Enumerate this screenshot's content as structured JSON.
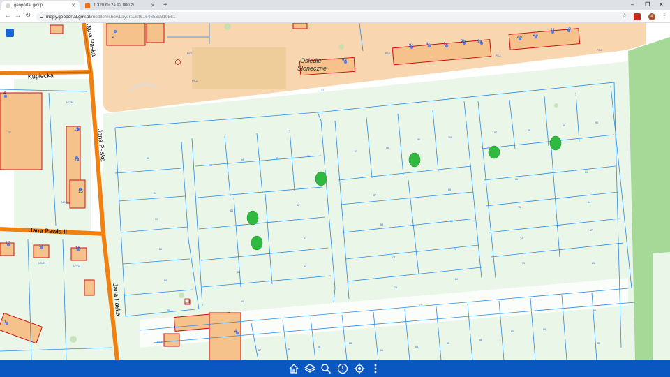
{
  "browser": {
    "tabs": [
      {
        "title": "geoportal.gov.pl",
        "active": true
      },
      {
        "title": "1 320 m² za 92 000 zł",
        "active": false
      }
    ],
    "new_tab_label": "+",
    "window_controls": [
      "–",
      "❐",
      "✕"
    ],
    "url": {
      "host": "mapy.geoportal.gov.pl",
      "path": "/mobile/#showLayersList&1646569319861"
    },
    "avatar_letter": "A"
  },
  "map": {
    "streets": [
      "Kupiecka",
      "Jana Paska",
      "Jana Paska",
      "Jana Pawła II",
      "Jana Paska"
    ],
    "osiedle": [
      "Osiedle",
      "Słoneczne"
    ],
    "house_numbers": [
      "1",
      "4",
      "15",
      "14",
      "1",
      "12",
      "10",
      "14",
      "16",
      "9",
      "9a",
      "9c",
      "9e",
      "9b",
      "9a",
      "9f",
      "4d",
      "4c",
      "4b",
      "4a",
      "11",
      "10",
      "4"
    ]
  },
  "bottom_bar": {
    "icons": [
      "home-icon",
      "layers-icon",
      "search-icon",
      "info-icon",
      "locate-icon",
      "more-icon"
    ]
  },
  "colors": {
    "bottom_bar": "#0a57c2",
    "parcel_fill": "#eaf6e8",
    "residential_fill": "#f8d7b0",
    "road": "#f08010",
    "building_fill": "#f4c28a",
    "building_stroke": "#d01010",
    "parcel_line": "#2a8be6",
    "forest": "#a6d897"
  }
}
